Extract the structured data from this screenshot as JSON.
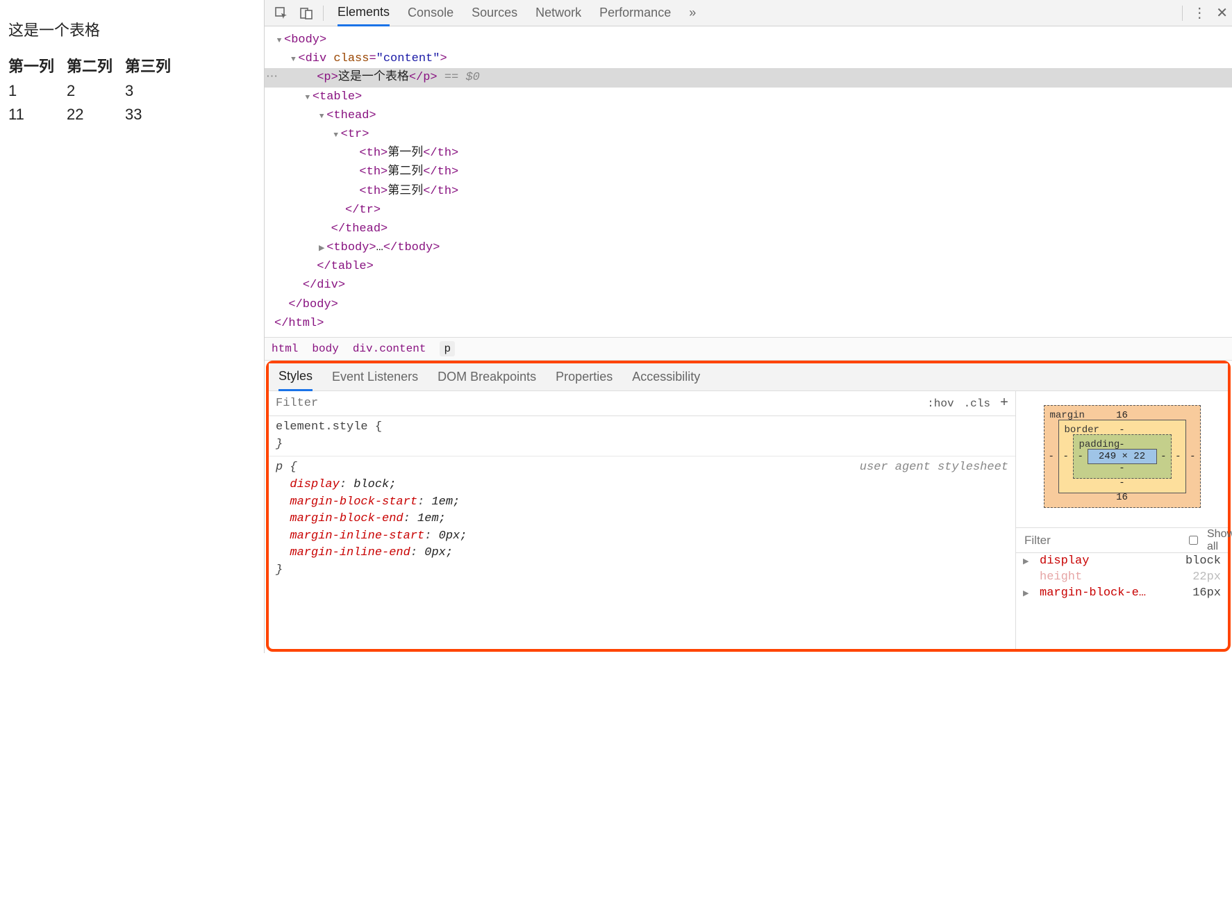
{
  "page": {
    "caption": "这是一个表格",
    "headers": [
      "第一列",
      "第二列",
      "第三列"
    ],
    "rows": [
      [
        "1",
        "2",
        "3"
      ],
      [
        "11",
        "22",
        "33"
      ]
    ]
  },
  "devtools": {
    "tabs": [
      "Elements",
      "Console",
      "Sources",
      "Network",
      "Performance"
    ],
    "more": "»",
    "dom": {
      "body_open": "<body>",
      "div_open_1": "<div ",
      "div_attr_name": "class",
      "div_attr_val": "\"content\"",
      "div_open_2": ">",
      "p_open": "<p>",
      "p_text": "这是一个表格",
      "p_close": "</p>",
      "p_suffix": " == $0",
      "table_open": "<table>",
      "thead_open": "<thead>",
      "tr_open": "<tr>",
      "th1_open": "<th>",
      "th1_text": "第一列",
      "th1_close": "</th>",
      "th2_open": "<th>",
      "th2_text": "第二列",
      "th2_close": "</th>",
      "th3_open": "<th>",
      "th3_text": "第三列",
      "th3_close": "</th>",
      "tr_close": "</tr>",
      "thead_close": "</thead>",
      "tbody_open": "<tbody>",
      "tbody_ell": "…",
      "tbody_close": "</tbody>",
      "table_close": "</table>",
      "div_close": "</div>",
      "body_close": "</body>",
      "html_close": "</html>"
    },
    "crumbs": [
      "html",
      "body",
      "div.content",
      "p"
    ]
  },
  "styles": {
    "tabs": [
      "Styles",
      "Event Listeners",
      "DOM Breakpoints",
      "Properties",
      "Accessibility"
    ],
    "filter_placeholder": "Filter",
    "hov": ":hov",
    "cls": ".cls",
    "element_style": "element.style {",
    "close_brace": "}",
    "user_agent": "user agent stylesheet",
    "rule_selector": "p {",
    "props": [
      {
        "name": "display",
        "value": "block;"
      },
      {
        "name": "margin-block-start",
        "value": "1em;"
      },
      {
        "name": "margin-block-end",
        "value": "1em;"
      },
      {
        "name": "margin-inline-start",
        "value": "0px;"
      },
      {
        "name": "margin-inline-end",
        "value": "0px;"
      }
    ]
  },
  "boxmodel": {
    "margin_label": "margin",
    "margin_top": "16",
    "margin_bottom": "16",
    "margin_left": "-",
    "margin_right": "-",
    "border_label": "border",
    "border_top": "-",
    "border_bottom": "-",
    "border_left": "-",
    "border_right": "-",
    "padding_label": "padding",
    "padding_top": "-",
    "padding_bottom": "-",
    "padding_left": "-",
    "padding_right": "-",
    "content": "249 × 22"
  },
  "computed": {
    "filter_placeholder": "Filter",
    "show_all": "Show all",
    "rows": [
      {
        "name": "display",
        "value": "block",
        "dim": false,
        "expandable": true
      },
      {
        "name": "height",
        "value": "22px",
        "dim": true,
        "expandable": false
      },
      {
        "name": "margin-block-e…",
        "value": "16px",
        "dim": false,
        "expandable": true
      }
    ]
  }
}
